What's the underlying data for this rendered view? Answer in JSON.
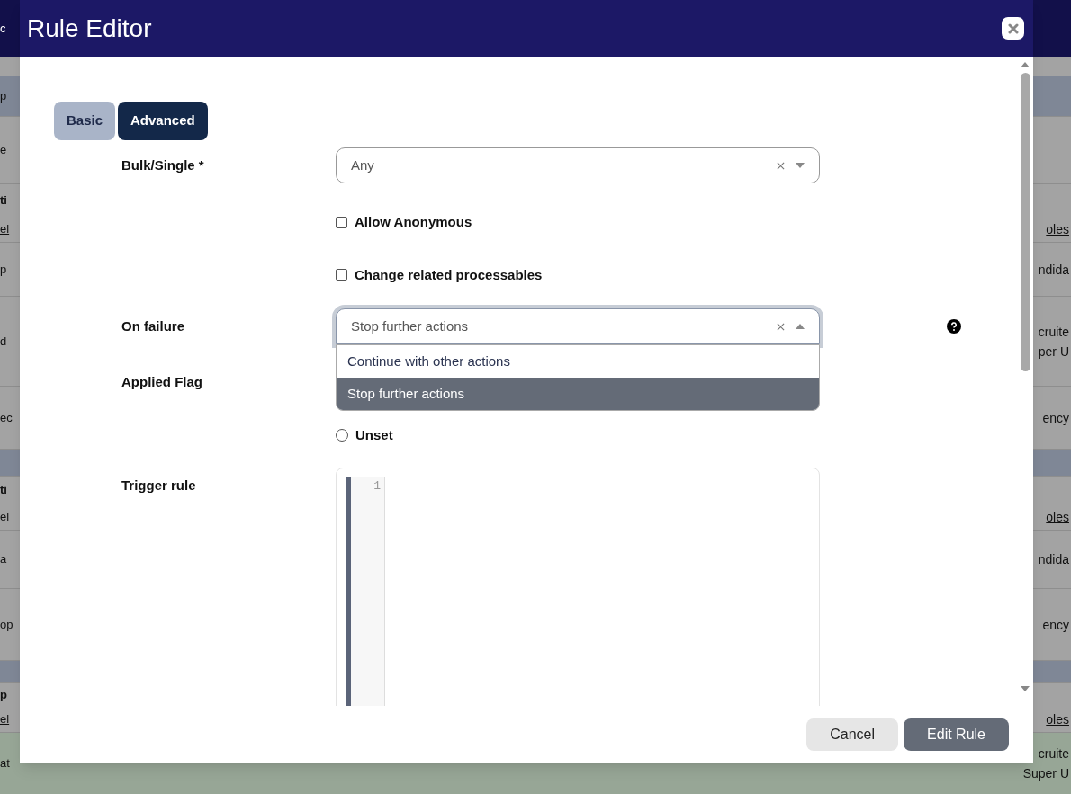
{
  "background": {
    "rows": [
      {
        "kind": "topbar",
        "left": "c",
        "right": []
      },
      {
        "kind": "gap",
        "left": "",
        "right": []
      },
      {
        "kind": "band",
        "left": "p",
        "right": []
      },
      {
        "kind": "plain",
        "left": "e",
        "right": []
      },
      {
        "kind": "heading",
        "left": "ti",
        "right": []
      },
      {
        "kind": "link",
        "left": "el",
        "right": [
          "oles"
        ]
      },
      {
        "kind": "plain",
        "left": "p",
        "right": [
          "ndida"
        ]
      },
      {
        "kind": "plain",
        "left": "d",
        "right": [
          "cruite",
          "per U"
        ]
      },
      {
        "kind": "plain",
        "left": "ec",
        "right": [
          "ency"
        ]
      },
      {
        "kind": "band",
        "left": "",
        "right": []
      },
      {
        "kind": "heading",
        "left": "ti",
        "right": []
      },
      {
        "kind": "link",
        "left": "el",
        "right": [
          "oles"
        ]
      },
      {
        "kind": "plain",
        "left": "a",
        "right": [
          "ndida"
        ]
      },
      {
        "kind": "plain",
        "left": "op",
        "right": [
          "ency"
        ]
      },
      {
        "kind": "band",
        "left": "",
        "right": []
      },
      {
        "kind": "heading",
        "left": "p",
        "right": []
      },
      {
        "kind": "link",
        "left": "el",
        "right": [
          "oles"
        ]
      },
      {
        "kind": "green",
        "left": "at",
        "right": [
          "cruite",
          "Super U"
        ]
      }
    ]
  },
  "modal": {
    "title": "Rule Editor",
    "tabs": [
      {
        "label": "Basic",
        "selected": false
      },
      {
        "label": "Advanced",
        "selected": true
      }
    ],
    "fields": [
      {
        "kind": "select",
        "label": "Bulk/Single *",
        "value": "Any",
        "open": false
      },
      {
        "kind": "checkbox",
        "text": "Allow Anonymous",
        "checked": false
      },
      {
        "kind": "checkbox",
        "text": "Change related processables",
        "checked": false
      },
      {
        "kind": "select",
        "label": "On failure",
        "value": "Stop further actions",
        "open": true,
        "help": true,
        "options": [
          {
            "label": "Continue with other actions",
            "selected": false
          },
          {
            "label": "Stop further actions",
            "selected": true
          }
        ]
      },
      {
        "kind": "radio",
        "label": "Applied Flag",
        "options": [
          {
            "label": "Unset",
            "selected": false
          }
        ]
      },
      {
        "kind": "code",
        "label": "Trigger rule",
        "line_numbers": [
          "1"
        ]
      }
    ],
    "buttons": [
      {
        "label": "Cancel",
        "kind": "secondary"
      },
      {
        "label": "Edit Rule",
        "kind": "primary"
      }
    ]
  }
}
